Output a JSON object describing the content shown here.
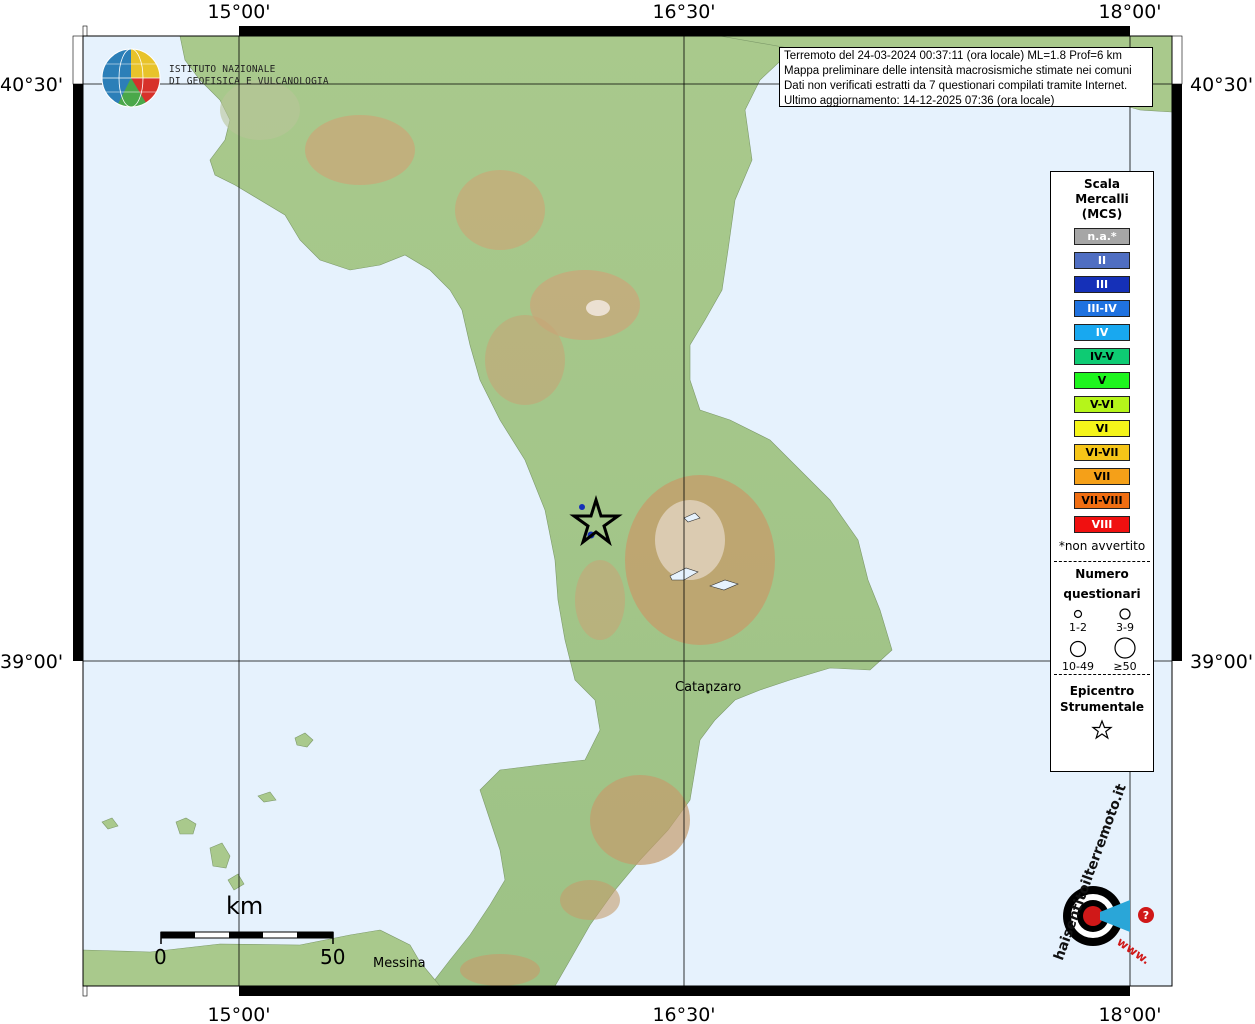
{
  "info": {
    "line1": "Terremoto del 24-03-2024 00:37:11 (ora locale) ML=1.8 Prof=6 km",
    "line2": "Mappa preliminare delle intensità macrosismiche stimate nei comuni",
    "line3": "Dati non verificati estratti da 7 questionari compilati tramite Internet.",
    "line4": "Ultimo aggiornamento: 14-12-2025 07:36 (ora locale)"
  },
  "axes": {
    "top": [
      "15°00'",
      "16°30'",
      "18°00'"
    ],
    "bottom": [
      "15°00'",
      "16°30'",
      "18°00'"
    ],
    "left": [
      "40°30'",
      "39°00'"
    ],
    "right": [
      "40°30'",
      "39°00'"
    ]
  },
  "places": {
    "catanzaro": "Catanzaro",
    "messina": "Messina"
  },
  "scale_bar": {
    "unit": "km",
    "start": "0",
    "end": "50"
  },
  "logo_ingv": {
    "line1": "ISTITUTO NAZIONALE",
    "line2": "DI GEOFISICA E VULCANOLOGIA"
  },
  "logo_hsit": {
    "text": "haisentitoilterremoto.it",
    "www": "www."
  },
  "legend": {
    "scale_title": [
      "Scala",
      "Mercalli",
      "(MCS)"
    ],
    "classes": [
      {
        "label": "n.a.*",
        "color": "#a6a6a6",
        "text_color": "#ffffff"
      },
      {
        "label": "II",
        "color": "#4f6ec2",
        "text_color": "#ffffff"
      },
      {
        "label": "III",
        "color": "#1530b8",
        "text_color": "#ffffff"
      },
      {
        "label": "III-IV",
        "color": "#1f72e0",
        "text_color": "#ffffff"
      },
      {
        "label": "IV",
        "color": "#18a8f0",
        "text_color": "#ffffff"
      },
      {
        "label": "IV-V",
        "color": "#0ecb73",
        "text_color": "#000000"
      },
      {
        "label": "V",
        "color": "#1ef51e",
        "text_color": "#000000"
      },
      {
        "label": "V-VI",
        "color": "#b5f51a",
        "text_color": "#000000"
      },
      {
        "label": "VI",
        "color": "#f5f51a",
        "text_color": "#000000"
      },
      {
        "label": "VI-VII",
        "color": "#f5c518",
        "text_color": "#000000"
      },
      {
        "label": "VII",
        "color": "#f5a018",
        "text_color": "#000000"
      },
      {
        "label": "VII-VIII",
        "color": "#f06e12",
        "text_color": "#000000"
      },
      {
        "label": "VIII",
        "color": "#f01010",
        "text_color": "#ffffff"
      }
    ],
    "note": "*non avvertito",
    "count_title": [
      "Numero",
      "questionari"
    ],
    "count_classes": [
      "1-2",
      "3-9",
      "10-49",
      "≥50"
    ],
    "epicenter_title": [
      "Epicentro",
      "Strumentale"
    ]
  },
  "colors": {
    "sea": "#e6f2fd",
    "land": "#a8c98a",
    "intensity_point": "#1530b8"
  },
  "observations": [
    {
      "intensity": "III",
      "questionnaires": "1-2"
    },
    {
      "intensity": "III",
      "questionnaires": "1-2"
    }
  ]
}
